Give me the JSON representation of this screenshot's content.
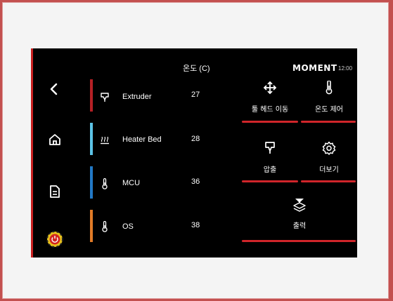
{
  "header": {
    "column_label": "온도 (C)",
    "brand": "MOMENT",
    "time": "12:00"
  },
  "sidebar": {
    "back_icon": "chevron-left-icon",
    "home_icon": "home-icon",
    "file_icon": "document-icon",
    "stop_icon": "emergency-stop-icon"
  },
  "temperatures": [
    {
      "name": "Extruder",
      "value": "27",
      "icon": "nozzle-icon",
      "color": "#b52025"
    },
    {
      "name": "Heater Bed",
      "value": "28",
      "icon": "heater-bed-icon",
      "color": "#5cc3e6"
    },
    {
      "name": "MCU",
      "value": "36",
      "icon": "thermometer-icon",
      "color": "#2279c6"
    },
    {
      "name": "OS",
      "value": "38",
      "icon": "thermometer-icon",
      "color": "#e17b27"
    }
  ],
  "tiles": {
    "move_head": "툴 헤드 이동",
    "temp_control": "온도 제어",
    "extrude": "압출",
    "more": "더보기",
    "print": "출력"
  },
  "colors": {
    "accent": "#d0252a",
    "screen_bg": "#000000",
    "frame_border": "#c3504f"
  }
}
